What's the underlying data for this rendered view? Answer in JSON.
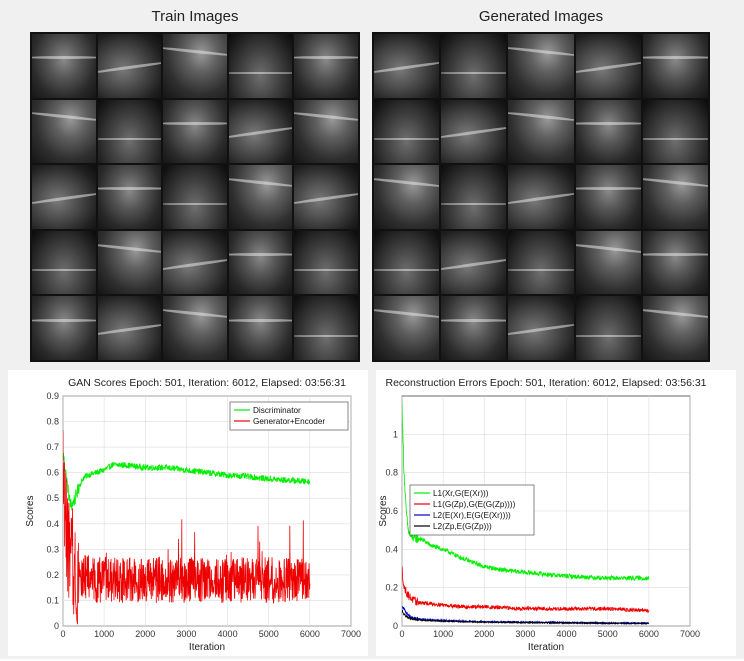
{
  "panels": {
    "train_title": "Train Images",
    "generated_title": "Generated Images"
  },
  "chart_data": [
    {
      "type": "line",
      "title": "GAN Scores Epoch: 501, Iteration: 6012, Elapsed: 03:56:31",
      "xlabel": "Iteration",
      "ylabel": "Scores",
      "xlim": [
        0,
        7000
      ],
      "ylim": [
        0,
        0.9
      ],
      "xticks": [
        0,
        1000,
        2000,
        3000,
        4000,
        5000,
        6000,
        7000
      ],
      "yticks": [
        0,
        0.1,
        0.2,
        0.3,
        0.4,
        0.5,
        0.6,
        0.7,
        0.8,
        0.9
      ],
      "grid": true,
      "legend_position": "top-right",
      "series": [
        {
          "name": "Discriminator",
          "color": "#00ee00",
          "noise": 0.012,
          "x": [
            0,
            50,
            100,
            150,
            200,
            300,
            400,
            500,
            600,
            800,
            1000,
            1200,
            1500,
            2000,
            2500,
            3000,
            3500,
            4000,
            4500,
            5000,
            5500,
            6000
          ],
          "y": [
            0.68,
            0.62,
            0.56,
            0.5,
            0.47,
            0.5,
            0.55,
            0.58,
            0.59,
            0.6,
            0.61,
            0.63,
            0.63,
            0.62,
            0.62,
            0.61,
            0.6,
            0.59,
            0.585,
            0.575,
            0.57,
            0.565
          ]
        },
        {
          "name": "Generator+Encoder",
          "color": "#ee0000",
          "noise": 0.09,
          "x": [
            0,
            50,
            100,
            150,
            200,
            300,
            400,
            500,
            600,
            800,
            1000,
            1500,
            2000,
            2500,
            3000,
            3500,
            4000,
            4500,
            5000,
            5500,
            6000
          ],
          "y": [
            0.5,
            0.45,
            0.35,
            0.28,
            0.24,
            0.21,
            0.2,
            0.19,
            0.19,
            0.18,
            0.18,
            0.18,
            0.18,
            0.18,
            0.18,
            0.18,
            0.18,
            0.18,
            0.18,
            0.18,
            0.18
          ]
        }
      ]
    },
    {
      "type": "line",
      "title": "Reconstruction Errors Epoch: 501, Iteration: 6012, Elapsed: 03:56:31",
      "xlabel": "Iteration",
      "ylabel": "Scores",
      "xlim": [
        0,
        7000
      ],
      "ylim": [
        0,
        1.2
      ],
      "xticks": [
        0,
        1000,
        2000,
        3000,
        4000,
        5000,
        6000,
        7000
      ],
      "yticks": [
        0,
        0.2,
        0.4,
        0.6,
        0.8,
        1
      ],
      "grid": true,
      "legend_position": "center-left",
      "series": [
        {
          "name": "L1(Xr,G(E(Xr)))",
          "color": "#00ee00",
          "noise": 0.012,
          "x": [
            0,
            50,
            100,
            150,
            200,
            300,
            500,
            700,
            1000,
            1500,
            2000,
            2500,
            3000,
            3500,
            4000,
            4500,
            5000,
            5500,
            6000
          ],
          "y": [
            1.15,
            0.8,
            0.6,
            0.5,
            0.47,
            0.46,
            0.45,
            0.42,
            0.4,
            0.35,
            0.31,
            0.29,
            0.28,
            0.27,
            0.26,
            0.255,
            0.25,
            0.25,
            0.25
          ]
        },
        {
          "name": "L1(G(Zp),G(E(G(Zp))))",
          "color": "#ee0000",
          "noise": 0.01,
          "x": [
            0,
            50,
            100,
            150,
            200,
            300,
            500,
            1000,
            1500,
            2000,
            3000,
            4000,
            5000,
            5500,
            6000
          ],
          "y": [
            0.3,
            0.2,
            0.18,
            0.16,
            0.15,
            0.13,
            0.12,
            0.11,
            0.1,
            0.1,
            0.09,
            0.09,
            0.09,
            0.085,
            0.08
          ]
        },
        {
          "name": "L2(E(Xr),E(G(E(Xr))))",
          "color": "#0000cc",
          "noise": 0.004,
          "x": [
            0,
            50,
            100,
            200,
            300,
            500,
            1000,
            1500,
            2000,
            3000,
            4000,
            5000,
            6000
          ],
          "y": [
            0.1,
            0.09,
            0.07,
            0.05,
            0.04,
            0.035,
            0.03,
            0.025,
            0.022,
            0.02,
            0.018,
            0.016,
            0.015
          ]
        },
        {
          "name": "L2(Zp,E(G(Zp)))",
          "color": "#000000",
          "noise": 0.003,
          "x": [
            0,
            50,
            100,
            200,
            300,
            500,
            1000,
            1500,
            2000,
            3000,
            4000,
            5000,
            6000
          ],
          "y": [
            0.08,
            0.06,
            0.05,
            0.04,
            0.035,
            0.03,
            0.025,
            0.022,
            0.02,
            0.018,
            0.016,
            0.014,
            0.013
          ]
        }
      ]
    }
  ]
}
